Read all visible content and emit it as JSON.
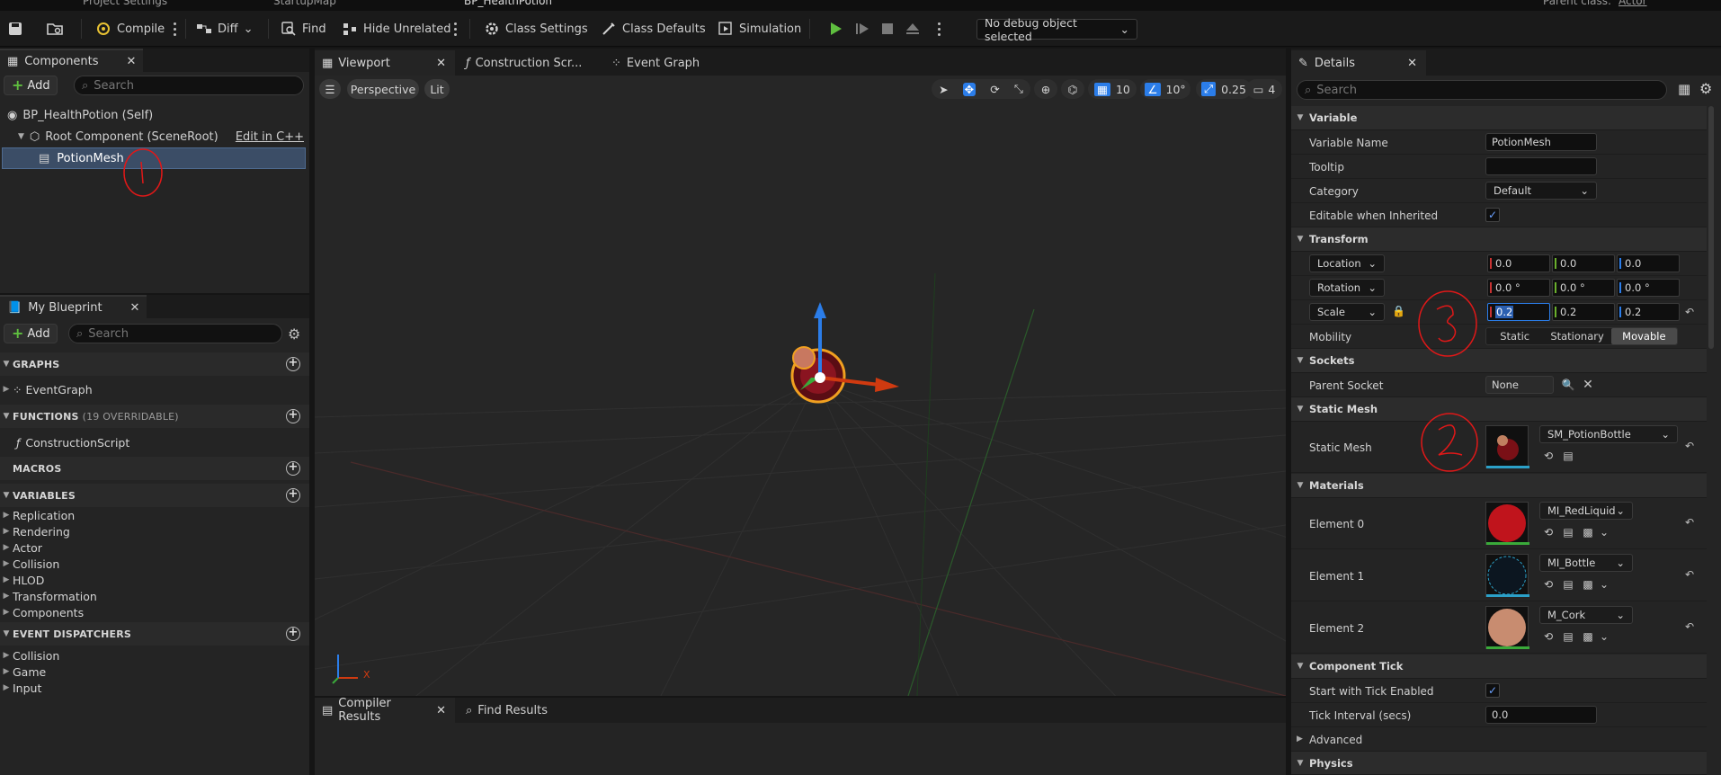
{
  "top_tabs": [
    "Project Settings",
    "StartupMap",
    "BP_HealthPotion"
  ],
  "top_right_text": "Parent class:",
  "top_right_link": "Actor",
  "toolbar": {
    "compile": "Compile",
    "diff": "Diff",
    "find": "Find",
    "hide_unrelated": "Hide Unrelated",
    "class_settings": "Class Settings",
    "class_defaults": "Class Defaults",
    "simulation": "Simulation",
    "debug_object": "No debug object selected"
  },
  "components": {
    "title": "Components",
    "add": "Add",
    "search_placeholder": "Search",
    "self": "BP_HealthPotion (Self)",
    "root": "Root Component (SceneRoot)",
    "edit_cpp": "Edit in C++",
    "mesh": "PotionMesh"
  },
  "my_blueprint": {
    "title": "My Blueprint",
    "add": "Add",
    "search_placeholder": "Search",
    "graphs_label": "GRAPHS",
    "graph_item": "EventGraph",
    "functions_label": "FUNCTIONS",
    "functions_count": "(19 OVERRIDABLE)",
    "function_item": "ConstructionScript",
    "macros_label": "MACROS",
    "variables_label": "VARIABLES",
    "variable_categories": [
      "Replication",
      "Rendering",
      "Actor",
      "Collision",
      "HLOD",
      "Transformation",
      "Components"
    ],
    "dispatchers_label": "EVENT DISPATCHERS",
    "dispatcher_categories": [
      "Collision",
      "Game",
      "Input"
    ]
  },
  "editor_tabs": {
    "viewport": "Viewport",
    "construction": "Construction Scr...",
    "event_graph": "Event Graph"
  },
  "viewport": {
    "perspective": "Perspective",
    "lit": "Lit",
    "grid_snap": "10",
    "rot_snap": "10°",
    "scale_snap": "0.25",
    "cam_speed": "4",
    "axis_x": "X"
  },
  "bottom_tabs": {
    "compiler": "Compiler Results",
    "find": "Find Results"
  },
  "details": {
    "title": "Details",
    "search_placeholder": "Search",
    "variable_section": "Variable",
    "variable_name_label": "Variable Name",
    "variable_name_value": "PotionMesh",
    "tooltip_label": "Tooltip",
    "tooltip_value": "",
    "category_label": "Category",
    "category_value": "Default",
    "editable_label": "Editable when Inherited",
    "transform_section": "Transform",
    "location_label": "Location",
    "location": [
      "0.0",
      "0.0",
      "0.0"
    ],
    "rotation_label": "Rotation",
    "rotation": [
      "0.0 °",
      "0.0 °",
      "0.0 °"
    ],
    "scale_label": "Scale",
    "scale": [
      "0.2",
      "0.2",
      "0.2"
    ],
    "mobility_label": "Mobility",
    "mobility_options": [
      "Static",
      "Stationary",
      "Movable"
    ],
    "mobility_selected": "Movable",
    "sockets_section": "Sockets",
    "parent_socket_label": "Parent Socket",
    "parent_socket_value": "None",
    "static_mesh_section": "Static Mesh",
    "static_mesh_label": "Static Mesh",
    "static_mesh_value": "SM_PotionBottle",
    "materials_section": "Materials",
    "materials": [
      {
        "label": "Element 0",
        "value": "MI_RedLiquid",
        "color": "#c0141c"
      },
      {
        "label": "Element 1",
        "value": "MI_Bottle",
        "color": "#0c1620"
      },
      {
        "label": "Element 2",
        "value": "M_Cork",
        "color": "#c88c70"
      }
    ],
    "tick_section": "Component Tick",
    "tick_start_label": "Start with Tick Enabled",
    "tick_interval_label": "Tick Interval (secs)",
    "tick_interval_value": "0.0",
    "advanced_label": "Advanced",
    "physics_section": "Physics"
  },
  "colors": {
    "accent_blue": "#2b7de9",
    "play_green": "#5fbf3f",
    "annotation_red": "#e01818"
  }
}
